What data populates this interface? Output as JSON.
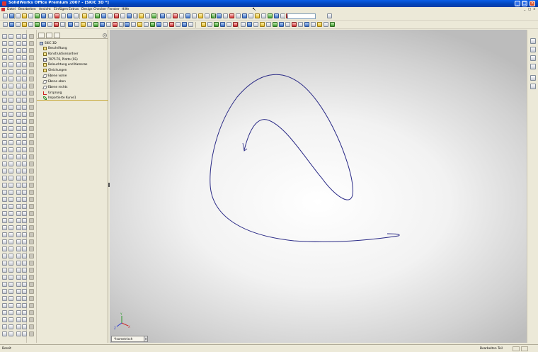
{
  "window": {
    "title": "SolidWorks Office Premium 2007 - [SKIC 3D *]"
  },
  "menu": {
    "items": [
      "Datei",
      "Bearbeiten",
      "Ansicht",
      "Einfügen",
      "Extras",
      "Design Checker",
      "Fenster",
      "Hilfe"
    ]
  },
  "feature_tree": {
    "root": "SKIC 3D",
    "items": [
      {
        "label": "Beschriftung",
        "icon": "annotation-icon"
      },
      {
        "label": "Konstruktionsordner",
        "icon": "folder-icon"
      },
      {
        "label": "7075-T6, Platte (SS)",
        "icon": "material-icon"
      },
      {
        "label": "Beleuchtung und Kameras",
        "icon": "lights-icon"
      },
      {
        "label": "Gleichungen",
        "icon": "equation-icon"
      },
      {
        "label": "Ebene vorne",
        "icon": "plane-icon"
      },
      {
        "label": "Ebene oben",
        "icon": "plane-icon"
      },
      {
        "label": "Ebene rechts",
        "icon": "plane-icon"
      },
      {
        "label": "Ursprung",
        "icon": "origin-icon"
      },
      {
        "label": "Importierte Kurve1",
        "icon": "curve-icon"
      }
    ]
  },
  "graphics": {
    "view_tab": "*Isometrisch",
    "curve_color": "#2a2a86"
  },
  "status": {
    "left": "Bereit",
    "right": "Bearbeiten Teil"
  }
}
